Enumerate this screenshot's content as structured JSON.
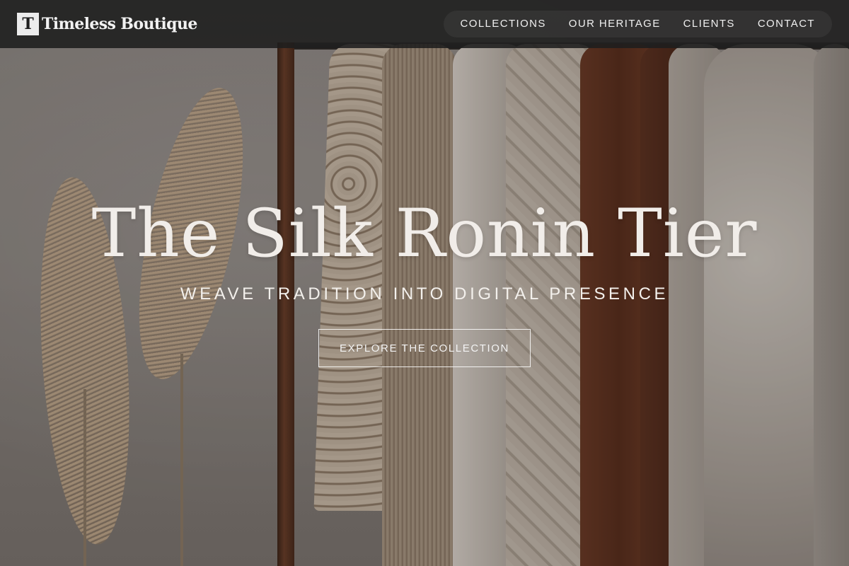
{
  "brand": {
    "logo_letter": "T",
    "name": "Timeless Boutique"
  },
  "nav": {
    "items": [
      {
        "label": "COLLECTIONS"
      },
      {
        "label": "OUR HERITAGE"
      },
      {
        "label": "CLIENTS"
      },
      {
        "label": "CONTACT"
      }
    ]
  },
  "hero": {
    "title": "The Silk Ronin Tier",
    "subtitle": "WEAVE TRADITION INTO DIGITAL PRESENCE",
    "cta_label": "EXPLORE THE COLLECTION"
  },
  "colors": {
    "header_bg": "#1e1e1e",
    "title_text": "#f1ede9",
    "accent_white": "#ffffff"
  }
}
